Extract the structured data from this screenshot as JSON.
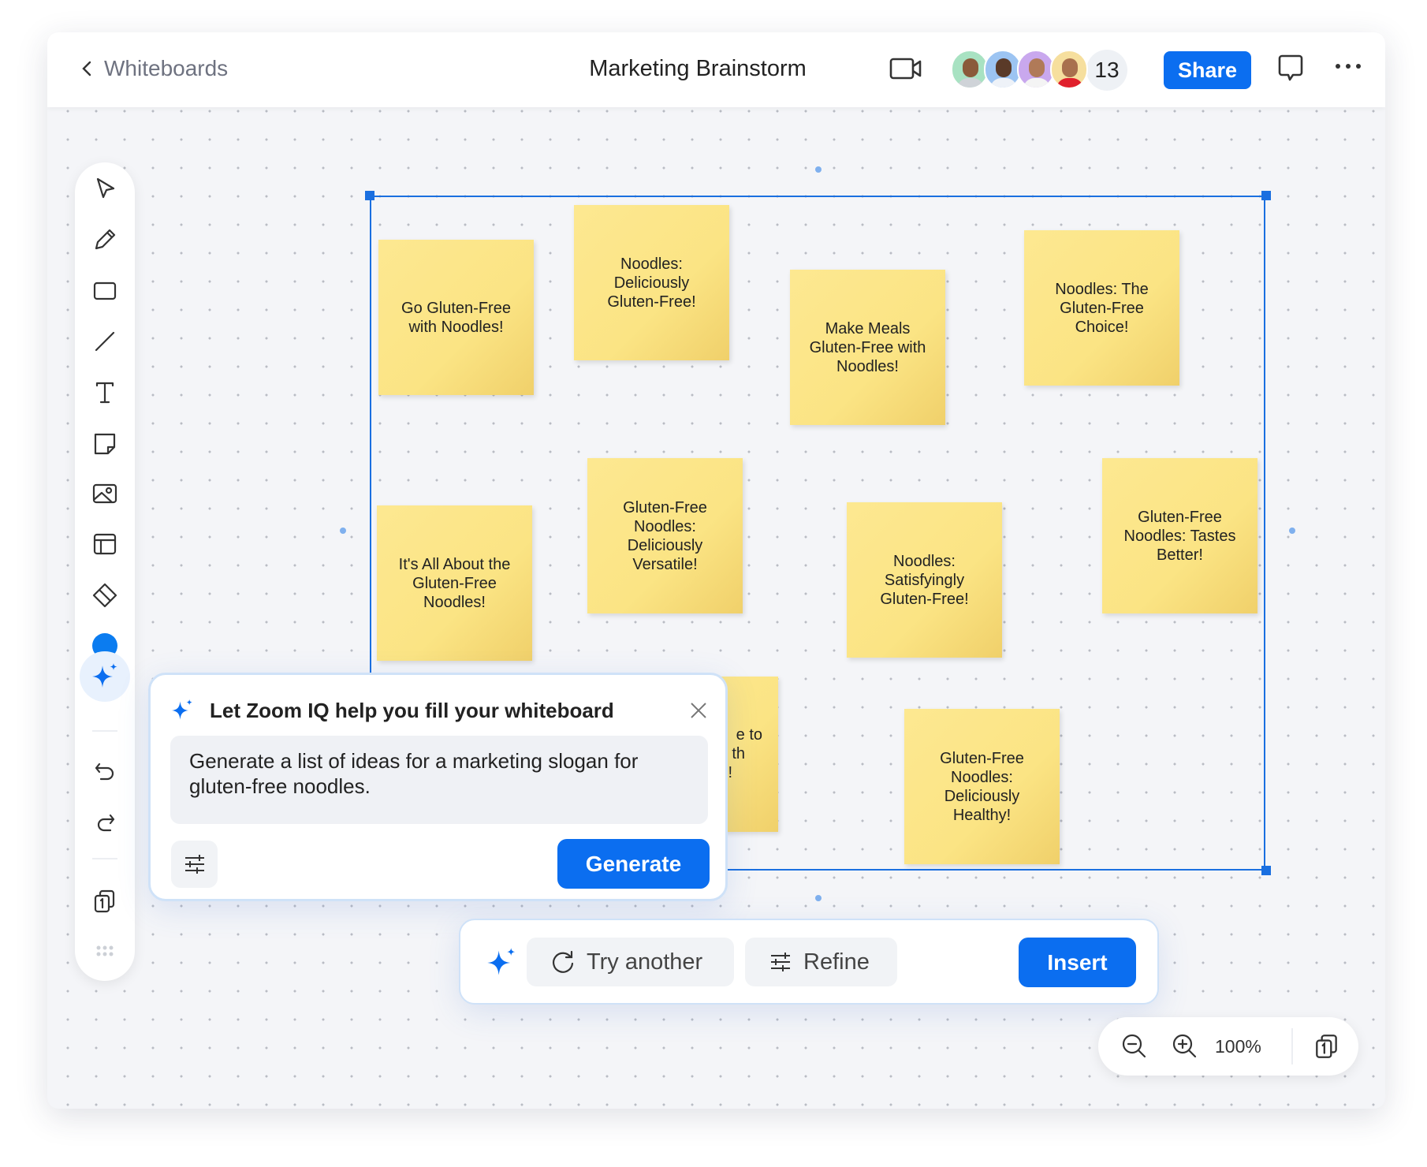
{
  "header": {
    "back_label": "Whiteboards",
    "title": "Marketing Brainstorm",
    "participant_count": "13",
    "share_label": "Share",
    "avatar_colors": [
      "#a8e2c2",
      "#9cc4f2",
      "#c9a8ee",
      "#f6df9e"
    ]
  },
  "toolbar": {
    "tools": [
      "select",
      "pen",
      "rectangle",
      "line",
      "text",
      "sticky-note",
      "image",
      "template",
      "eraser",
      "color",
      "zoom-iq",
      "undo",
      "redo",
      "pages",
      "more"
    ],
    "active_color": "#0b7cf0"
  },
  "notes": [
    "Go Gluten-Free with Noodles!",
    "Noodles: Deliciously Gluten-Free!",
    "Make Meals Gluten-Free with Noodles!",
    "Noodles: The Gluten-Free Choice!",
    "It's All About the Gluten-Free Noodles!",
    "Gluten-Free Noodles: Deliciously Versatile!",
    "Noodles: Satisfyingly Gluten-Free!",
    "Gluten-Free Noodles: Tastes Better!",
    "Gluten-Free Noodles: Deliciously Healthy!"
  ],
  "partial_note_lines": [
    "e to",
    "th",
    "!"
  ],
  "dialog": {
    "title": "Let Zoom IQ help you fill your whiteboard",
    "prompt": "Generate a list of ideas for a marketing slogan for gluten-free noodles.",
    "generate_label": "Generate"
  },
  "result_bar": {
    "try_another_label": "Try another",
    "refine_label": "Refine",
    "insert_label": "Insert"
  },
  "zoom": {
    "level": "100%",
    "page": "1"
  },
  "colors": {
    "accent": "#0b6ef0",
    "sticky": "#fbe484",
    "selection": "#1a6fe0"
  }
}
